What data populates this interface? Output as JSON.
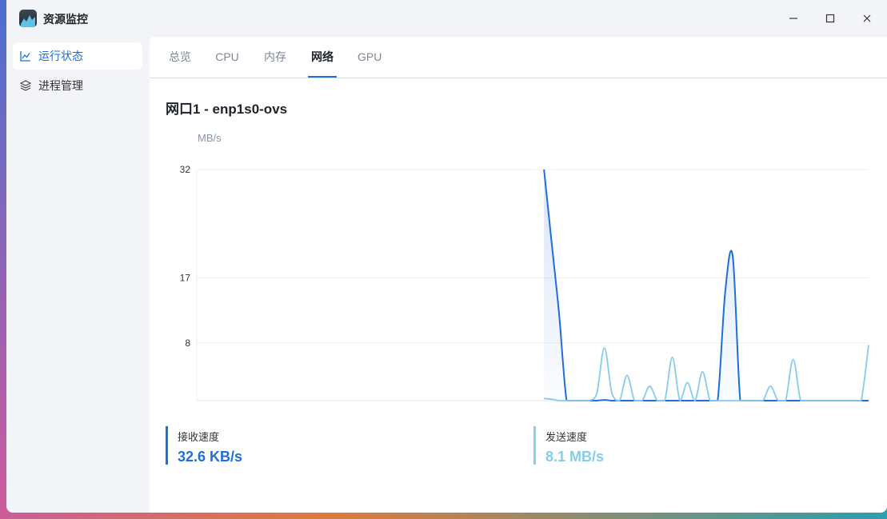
{
  "window": {
    "title": "资源监控",
    "controls": [
      "minimize",
      "maximize",
      "close"
    ]
  },
  "sidebar": {
    "items": [
      {
        "label": "运行状态",
        "icon": "line-chart-icon",
        "active": true
      },
      {
        "label": "进程管理",
        "icon": "layers-icon",
        "active": false
      }
    ]
  },
  "tabs": [
    {
      "label": "总览",
      "active": false
    },
    {
      "label": "CPU",
      "active": false
    },
    {
      "label": "内存",
      "active": false
    },
    {
      "label": "网络",
      "active": true
    },
    {
      "label": "GPU",
      "active": false
    }
  ],
  "section": {
    "title": "网口1 - enp1s0-ovs",
    "unit": "MB/s"
  },
  "chart_data": {
    "type": "line",
    "ylabel": "MB/s",
    "ylim": [
      0,
      32
    ],
    "yticks": [
      8,
      17,
      32
    ],
    "x_points": 60,
    "series": [
      {
        "name": "接收速度",
        "color": "#1e6fd9",
        "values": [
          null,
          null,
          null,
          null,
          null,
          null,
          null,
          null,
          null,
          null,
          null,
          null,
          null,
          null,
          null,
          null,
          null,
          null,
          null,
          null,
          null,
          null,
          null,
          null,
          null,
          null,
          null,
          null,
          null,
          null,
          null,
          null,
          null,
          null,
          null,
          null,
          null,
          null,
          null,
          null,
          null,
          null,
          null,
          null,
          null,
          null,
          32,
          22,
          12,
          0,
          0,
          0,
          0,
          0,
          0.1,
          0,
          0,
          0,
          0,
          0,
          0,
          0,
          0,
          0,
          0,
          0,
          0,
          0,
          0,
          0,
          15,
          20,
          0,
          0,
          0,
          0,
          0,
          0,
          0,
          0,
          0,
          0,
          0,
          0,
          0,
          0,
          0,
          0,
          0,
          0
        ]
      },
      {
        "name": "发送速度",
        "color": "#86cdea",
        "values": [
          null,
          null,
          null,
          null,
          null,
          null,
          null,
          null,
          null,
          null,
          null,
          null,
          null,
          null,
          null,
          null,
          null,
          null,
          null,
          null,
          null,
          null,
          null,
          null,
          null,
          null,
          null,
          null,
          null,
          null,
          null,
          null,
          null,
          null,
          null,
          null,
          null,
          null,
          null,
          null,
          null,
          null,
          null,
          null,
          null,
          null,
          0.3,
          0.2,
          0,
          0,
          0,
          0,
          0,
          1,
          7.3,
          1,
          0,
          3.5,
          0,
          0,
          2,
          0,
          0,
          6,
          0,
          2.5,
          0,
          4,
          0,
          0,
          0,
          0,
          0,
          0,
          0,
          0,
          2,
          0,
          0,
          5.7,
          0,
          0,
          0,
          0,
          0,
          0,
          0,
          0,
          0,
          7.7
        ]
      }
    ]
  },
  "stats": {
    "rx": {
      "label": "接收速度",
      "value": "32.6 KB/s"
    },
    "tx": {
      "label": "发送速度",
      "value": "8.1 MB/s"
    }
  }
}
